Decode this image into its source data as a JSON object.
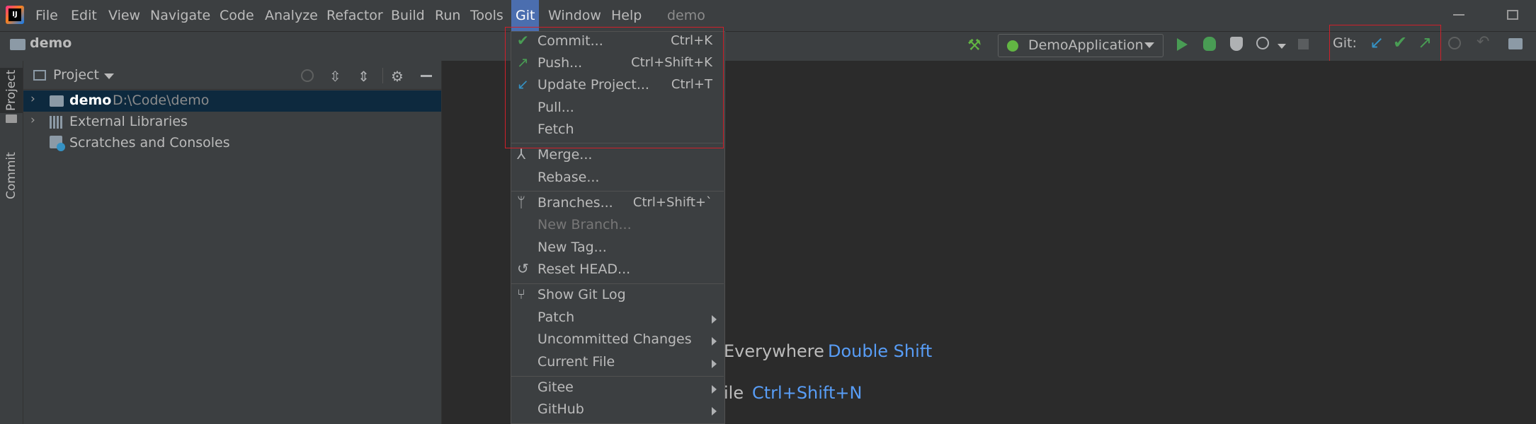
{
  "app": {
    "project_title": "demo"
  },
  "menubar": {
    "items": [
      {
        "label": "File"
      },
      {
        "label": "Edit"
      },
      {
        "label": "View"
      },
      {
        "label": "Navigate"
      },
      {
        "label": "Code"
      },
      {
        "label": "Analyze"
      },
      {
        "label": "Refactor"
      },
      {
        "label": "Build"
      },
      {
        "label": "Run"
      },
      {
        "label": "Tools"
      },
      {
        "label": "Git"
      },
      {
        "label": "Window"
      },
      {
        "label": "Help"
      }
    ],
    "active": "Git"
  },
  "navbar": {
    "project": "demo",
    "run_config": "DemoApplication",
    "git_label": "Git:"
  },
  "stripe": {
    "project_tab": "Project",
    "commit_tab": "Commit"
  },
  "project_panel": {
    "title": "Project",
    "tree": [
      {
        "name": "demo",
        "path": "D:\\Code\\demo"
      },
      {
        "name": "External Libraries"
      },
      {
        "name": "Scratches and Consoles"
      }
    ]
  },
  "git_menu": {
    "items": [
      {
        "label": "Commit...",
        "shortcut": "Ctrl+K",
        "icon": "check-icon"
      },
      {
        "label": "Push...",
        "shortcut": "Ctrl+Shift+K",
        "icon": "push-arrow-icon"
      },
      {
        "label": "Update Project...",
        "shortcut": "Ctrl+T",
        "icon": "update-arrow-icon"
      },
      {
        "label": "Pull..."
      },
      {
        "label": "Fetch"
      },
      {
        "label": "Merge...",
        "icon": "merge-icon"
      },
      {
        "label": "Rebase..."
      },
      {
        "label": "Branches...",
        "shortcut": "Ctrl+Shift+`",
        "icon": "branch-icon"
      },
      {
        "label": "New Branch...",
        "disabled": true
      },
      {
        "label": "New Tag..."
      },
      {
        "label": "Reset HEAD...",
        "icon": "reset-icon"
      },
      {
        "label": "Show Git Log",
        "icon": "git-log-icon"
      },
      {
        "label": "Patch",
        "submenu": true
      },
      {
        "label": "Uncommitted Changes",
        "submenu": true
      },
      {
        "label": "Current File",
        "submenu": true
      },
      {
        "label": "Gitee",
        "submenu": true
      },
      {
        "label": "GitHub",
        "submenu": true
      }
    ]
  },
  "editor_hints": [
    {
      "text": "Everywhere",
      "key": "Double Shift"
    },
    {
      "text": "ile",
      "key": "Ctrl+Shift+N"
    }
  ],
  "colors": {
    "accent_blue": "#4b6eaf",
    "git_green": "#499c54",
    "git_blue": "#3592c4",
    "highlight_red": "#d0202a",
    "key_blue": "#589df6"
  }
}
